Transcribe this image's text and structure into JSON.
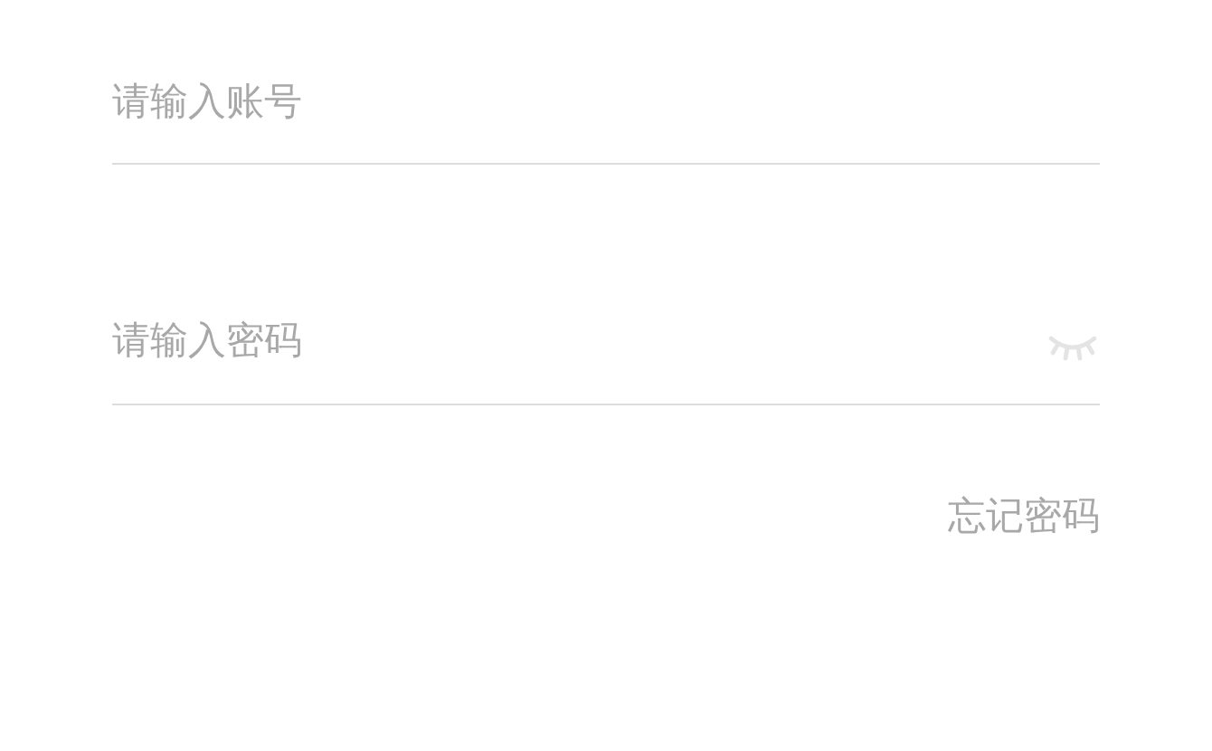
{
  "fields": [
    {
      "kind": "text",
      "placeholder": "请输入账号"
    },
    {
      "kind": "password",
      "placeholder": "请输入密码"
    }
  ],
  "forgot_link": "忘记密码"
}
